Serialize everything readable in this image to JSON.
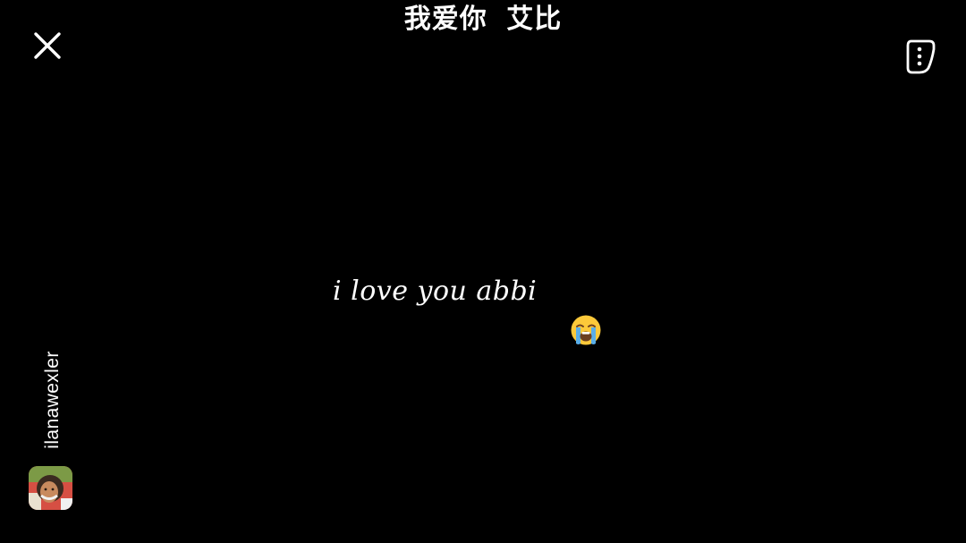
{
  "story": {
    "caption": "我爱你  艾比",
    "text": "i love you abbi",
    "emoji": "loudly-crying-face",
    "author": {
      "username": "ilanawexler",
      "avatar": "profile-photo"
    }
  },
  "controls": {
    "close_icon": "close-icon",
    "menu_icon": "more-vertical-icon"
  },
  "colors": {
    "background": "#000000",
    "text": "#ffffff",
    "emoji_face": "#fcc93a",
    "emoji_tears": "#5aaee8"
  }
}
